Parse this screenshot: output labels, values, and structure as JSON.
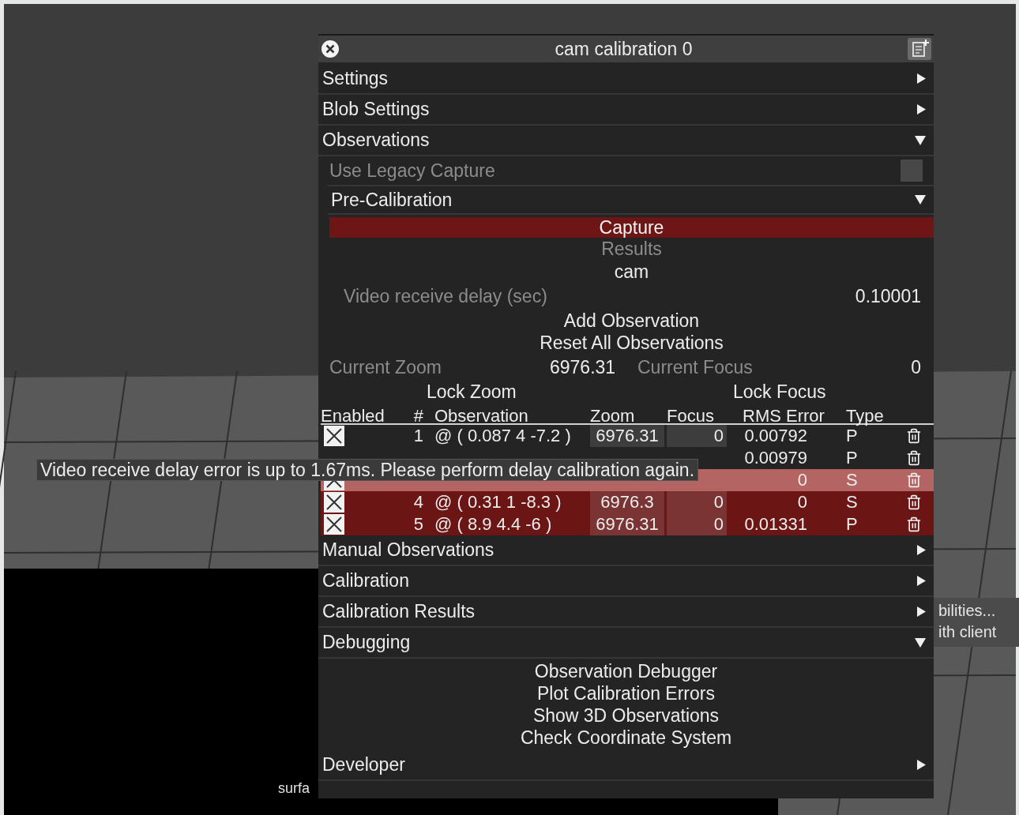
{
  "window": {
    "title": "cam calibration 0"
  },
  "sections": [
    {
      "title": "Settings",
      "expanded": false
    },
    {
      "title": "Blob Settings",
      "expanded": false
    },
    {
      "title": "Observations",
      "expanded": true,
      "legacy_capture": {
        "label": "Use Legacy Capture",
        "checked": false
      },
      "pre_calibration": {
        "title": "Pre-Calibration",
        "expanded": true,
        "capture_button": "Capture",
        "results_label": "Results",
        "camera": "cam",
        "delay": {
          "label": "Video receive delay (sec)",
          "value": "0.10001"
        },
        "buttons": [
          "Add Observation",
          "Reset All Observations"
        ],
        "current_zoom": {
          "label": "Current Zoom",
          "value": "6976.31"
        },
        "current_focus": {
          "label": "Current Focus",
          "value": "0"
        },
        "lock_zoom": "Lock Zoom",
        "lock_focus": "Lock Focus",
        "table": {
          "columns": [
            "Enabled",
            "#",
            "Observation",
            "Zoom",
            "Focus",
            "RMS Error",
            "Type"
          ],
          "rows": [
            {
              "checked": true,
              "number": "1",
              "observation": "@ ( 0.087 4 -7.2 )",
              "zoom": "6976.31",
              "focus": "0",
              "rms_error": "0.00792",
              "type": "P",
              "kind": "normal"
            },
            {
              "rms_error": "0.00979",
              "type": "P",
              "kind": "normal"
            },
            {
              "checked": true,
              "rms_error": "0",
              "type": "S",
              "kind": "hover"
            },
            {
              "checked": true,
              "number": "4",
              "observation": "@ ( 0.31 1 -8.3 )",
              "zoom": "6976.3",
              "focus": "0",
              "rms_error": "0",
              "type": "S",
              "kind": "error"
            },
            {
              "checked": true,
              "number": "5",
              "observation": "@ ( 8.9 4.4 -6 )",
              "zoom": "6976.31",
              "focus": "0",
              "rms_error": "0.01331",
              "type": "P",
              "kind": "error"
            }
          ]
        }
      }
    },
    {
      "title": "Manual Observations",
      "expanded": false
    },
    {
      "title": "Calibration",
      "expanded": false
    },
    {
      "title": "Calibration Results",
      "expanded": false
    },
    {
      "title": "Debugging",
      "expanded": true,
      "buttons": [
        "Observation Debugger",
        "Plot Calibration Errors",
        "Show 3D Observations",
        "Check Coordinate System"
      ]
    },
    {
      "title": "Developer",
      "expanded": false
    }
  ],
  "tooltip": "Video receive delay error is up to 1.67ms. Please perform delay calibration again.",
  "background_labels": {
    "bottom_left": "surfa",
    "right_popup": [
      "bilities...",
      "ith client"
    ]
  }
}
